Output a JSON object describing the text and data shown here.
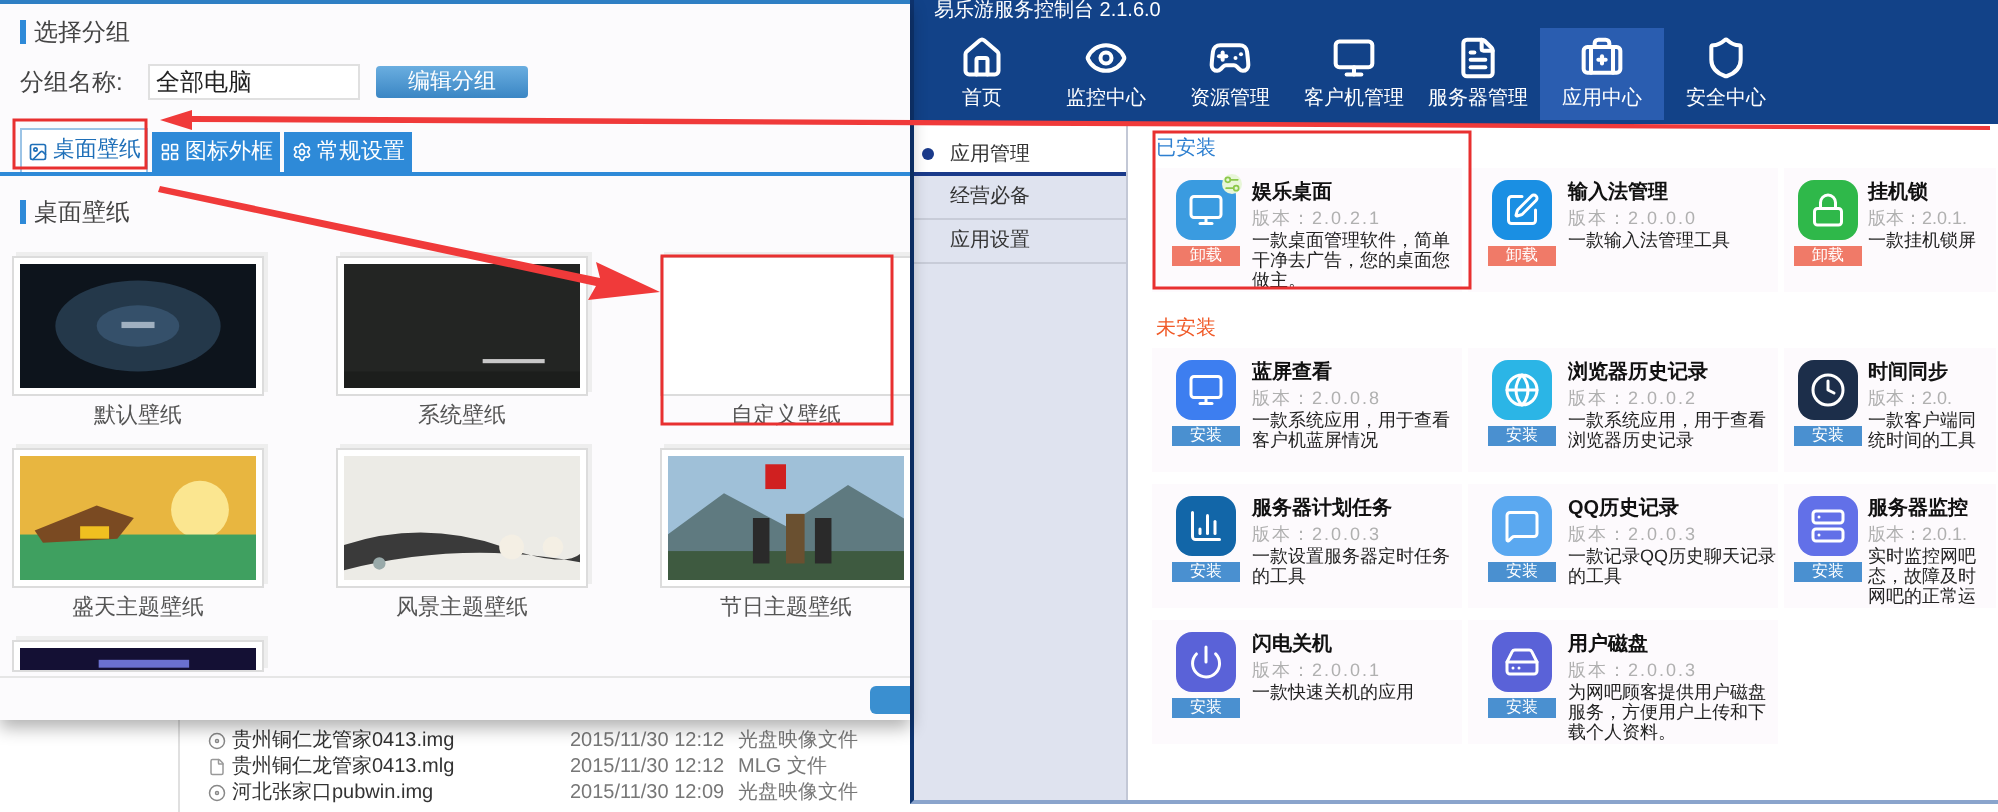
{
  "left_dialog": {
    "section_title": "选择分组",
    "group_label": "分组名称:",
    "group_field": {
      "value": "全部电脑"
    },
    "edit_button": "编辑分组",
    "tabs": [
      {
        "label": "桌面壁纸",
        "selected": true
      },
      {
        "label": "图标外框",
        "selected": false
      },
      {
        "label": "常规设置",
        "selected": false
      }
    ],
    "wallpaper_heading": "桌面壁纸",
    "wallpapers": [
      {
        "label": "默认壁纸",
        "kind": "picture"
      },
      {
        "label": "系统壁纸",
        "kind": "picture"
      },
      {
        "label": "自定义壁纸",
        "kind": "blank"
      },
      {
        "label": "盛天主题壁纸",
        "kind": "picture"
      },
      {
        "label": "风景主题壁纸",
        "kind": "picture"
      },
      {
        "label": "节日主题壁纸",
        "kind": "picture"
      },
      {
        "kind": "picture"
      }
    ]
  },
  "file_list": {
    "rows": [
      {
        "name": "贵州铜仁龙管家0413.img",
        "date": "2015/11/30 12:12",
        "type": "光盘映像文件",
        "kind": "disc"
      },
      {
        "name": "贵州铜仁龙管家0413.mlg",
        "date": "2015/11/30 12:12",
        "type": "MLG 文件",
        "kind": "file"
      },
      {
        "name": "河北张家口pubwin.img",
        "date": "2015/11/30 12:09",
        "type": "光盘映像文件",
        "kind": "disc"
      }
    ]
  },
  "console": {
    "title": "易乐游服务控制台 2.1.6.0",
    "nav": [
      {
        "label": "首页",
        "selected": false
      },
      {
        "label": "监控中心",
        "selected": false
      },
      {
        "label": "资源管理",
        "selected": false
      },
      {
        "label": "客户机管理",
        "selected": false
      },
      {
        "label": "服务器管理",
        "selected": false
      },
      {
        "label": "应用中心",
        "selected": true
      },
      {
        "label": "安全中心",
        "selected": false
      }
    ],
    "sidebar": [
      {
        "label": "应用管理",
        "selected": true
      },
      {
        "label": "经营必备",
        "selected": false
      },
      {
        "label": "应用设置",
        "selected": false
      }
    ],
    "sections": [
      {
        "heading": "已安装",
        "kind": "installed",
        "apps": [
          {
            "name": "娱乐桌面",
            "version": "版本：2.0.2.1",
            "desc": "一款桌面管理软件，简单干净去广告，您的桌面您做主。",
            "action": "卸载"
          },
          {
            "name": "输入法管理",
            "version": "版本：2.0.0.0",
            "desc": "一款输入法管理工具",
            "action": "卸载"
          },
          {
            "name": "挂机锁",
            "version": "版本：2.0.1.",
            "desc": "一款挂机锁屏",
            "action": "卸载"
          }
        ]
      },
      {
        "heading": "未安装",
        "kind": "not_installed",
        "apps": [
          {
            "name": "蓝屏查看",
            "version": "版本：2.0.0.8",
            "desc": "一款系统应用，用于查看客户机蓝屏情况",
            "action": "安装"
          },
          {
            "name": "浏览器历史记录",
            "version": "版本：2.0.0.2",
            "desc": "一款系统应用，用于查看浏览器历史记录",
            "action": "安装"
          },
          {
            "name": "时间同步",
            "version": "版本：2.0.",
            "desc": "一款客户端同统时间的工具",
            "action": "安装"
          },
          {
            "name": "服务器计划任务",
            "version": "版本：2.0.0.3",
            "desc": "一款设置服务器定时任务的工具",
            "action": "安装"
          },
          {
            "name": "QQ历史记录",
            "version": "版本：2.0.0.3",
            "desc": "一款记录QQ历史聊天记录的工具",
            "action": "安装"
          },
          {
            "name": "服务器监控",
            "version": "版本：2.0.1.",
            "desc": "实时监控网吧态，故障及时网吧的正常运",
            "action": "安装"
          },
          {
            "name": "闪电关机",
            "version": "版本：2.0.0.1",
            "desc": "一款快速关机的应用",
            "action": "安装"
          },
          {
            "name": "用户磁盘",
            "version": "版本：2.0.0.3",
            "desc": "为网吧顾客提供用户磁盘服务，方便用户上传和下载个人资料。",
            "action": "安装"
          }
        ]
      }
    ]
  }
}
